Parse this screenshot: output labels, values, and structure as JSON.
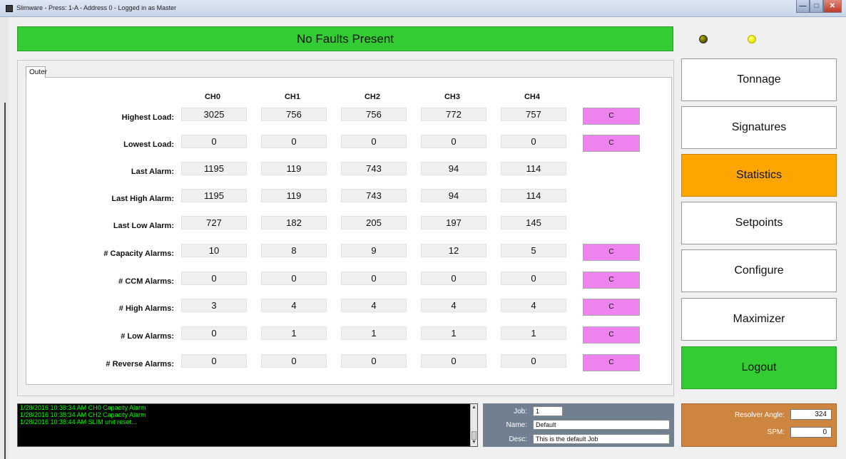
{
  "window": {
    "title": "Slimware - Press: 1-A - Address 0 - Logged in as Master",
    "controls": {
      "minimize": "—",
      "maximize": "□",
      "close": "✕"
    }
  },
  "status": {
    "fault_text": "No Faults Present"
  },
  "indicators": {
    "led1_color": "#7a7500",
    "led2_color": "#ffff33"
  },
  "tab": {
    "label": "Outer"
  },
  "table": {
    "columns": [
      "CH0",
      "CH1",
      "CH2",
      "CH3",
      "CH4"
    ],
    "clear_label": "C",
    "rows": [
      {
        "label": "Highest Load:",
        "values": [
          "3025",
          "756",
          "756",
          "772",
          "757"
        ],
        "clear": true
      },
      {
        "label": "Lowest Load:",
        "values": [
          "0",
          "0",
          "0",
          "0",
          "0"
        ],
        "clear": true
      },
      {
        "label": "Last Alarm:",
        "values": [
          "1195",
          "119",
          "743",
          "94",
          "114"
        ],
        "clear": false
      },
      {
        "label": "Last High Alarm:",
        "values": [
          "1195",
          "119",
          "743",
          "94",
          "114"
        ],
        "clear": false
      },
      {
        "label": "Last Low Alarm:",
        "values": [
          "727",
          "182",
          "205",
          "197",
          "145"
        ],
        "clear": false
      },
      {
        "label": "# Capacity Alarms:",
        "values": [
          "10",
          "8",
          "9",
          "12",
          "5"
        ],
        "clear": true
      },
      {
        "label": "# CCM Alarms:",
        "values": [
          "0",
          "0",
          "0",
          "0",
          "0"
        ],
        "clear": true
      },
      {
        "label": "# High Alarms:",
        "values": [
          "3",
          "4",
          "4",
          "4",
          "4"
        ],
        "clear": true
      },
      {
        "label": "# Low Alarms:",
        "values": [
          "0",
          "1",
          "1",
          "1",
          "1"
        ],
        "clear": true
      },
      {
        "label": "# Reverse Alarms:",
        "values": [
          "0",
          "0",
          "0",
          "0",
          "0"
        ],
        "clear": true
      }
    ]
  },
  "nav": {
    "items": [
      {
        "label": "Tonnage",
        "state": "normal"
      },
      {
        "label": "Signatures",
        "state": "normal"
      },
      {
        "label": "Statistics",
        "state": "active"
      },
      {
        "label": "Setpoints",
        "state": "normal"
      },
      {
        "label": "Configure",
        "state": "normal"
      },
      {
        "label": "Maximizer",
        "state": "normal"
      },
      {
        "label": "Logout",
        "state": "logout"
      }
    ]
  },
  "log": {
    "lines": [
      "1/28/2016 10:38:34 AM  CH0 Capacity Alarm",
      "1/28/2016 10:38:34 AM  CH2 Capacity Alarm",
      "1/28/2016 10:38:44 AM  SLIM unit reset..."
    ]
  },
  "job": {
    "job_label": "Job:",
    "job_value": "1",
    "name_label": "Name:",
    "name_value": "Default",
    "desc_label": "Desc:",
    "desc_value": "This is the default Job"
  },
  "resolver": {
    "angle_label": "Resolver Angle:",
    "angle_value": "324",
    "spm_label": "SPM:",
    "spm_value": "0"
  },
  "colors": {
    "fault_ok": "#33cc33",
    "nav_active": "#ffa500",
    "logout": "#33cc33",
    "clear_button": "#ee82ee",
    "job_panel": "#708090",
    "resolver_panel": "#cd853f",
    "log_text": "#00ff00"
  }
}
